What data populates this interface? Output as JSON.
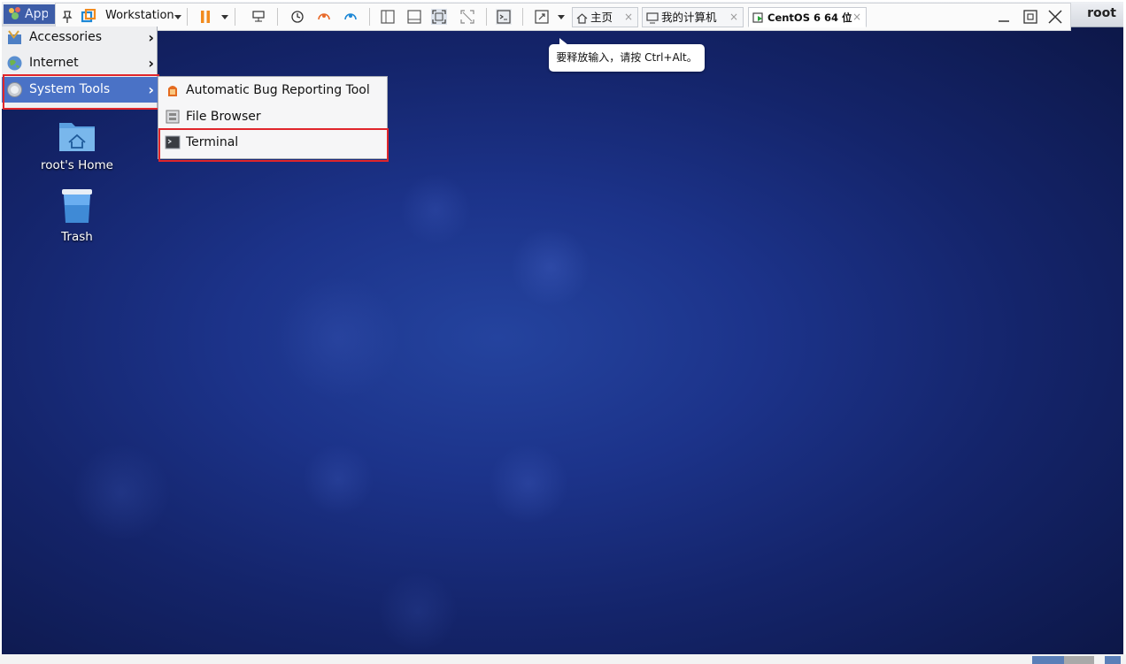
{
  "panel": {
    "apps_label": "Applications",
    "user": "root"
  },
  "vmware": {
    "workstation_label": "Workstation",
    "tabs": [
      {
        "label": "主页",
        "close": "×"
      },
      {
        "label": "我的计算机",
        "close": "×"
      },
      {
        "label": "CentOS 6 64 位",
        "close": "×"
      }
    ],
    "tooltip": "要释放输入，请按 Ctrl+Alt。"
  },
  "menu": {
    "items": [
      {
        "label": "Accessories",
        "arrow": "›"
      },
      {
        "label": "Internet",
        "arrow": "›"
      },
      {
        "label": "System Tools",
        "arrow": "›"
      }
    ]
  },
  "submenu": {
    "items": [
      {
        "label": "Automatic Bug Reporting Tool"
      },
      {
        "label": "File Browser"
      },
      {
        "label": "Terminal"
      }
    ]
  },
  "desktop": {
    "icons": [
      {
        "label": "root's Home"
      },
      {
        "label": "Trash"
      }
    ]
  },
  "colors": {
    "desktop_bg": "#1c338a",
    "menu_highlight": "#4a72c6",
    "annotation_red": "#e0262b"
  }
}
